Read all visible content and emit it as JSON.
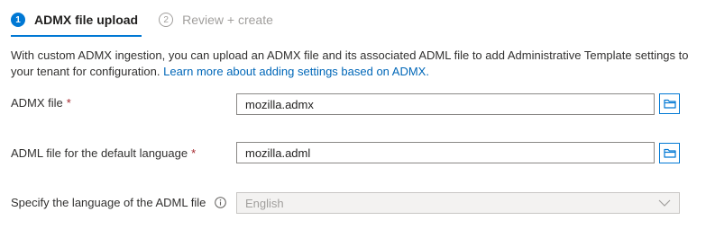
{
  "wizard": {
    "steps": [
      {
        "number": "1",
        "label": "ADMX file upload",
        "active": true
      },
      {
        "number": "2",
        "label": "Review + create",
        "active": false
      }
    ]
  },
  "description": {
    "text": "With custom ADMX ingestion, you can upload an ADMX file and its associated ADML file to add Administrative Template settings to your tenant for configuration. ",
    "link": "Learn more about adding settings based on ADMX."
  },
  "form": {
    "admx_file": {
      "label": "ADMX file",
      "required_marker": "*",
      "value": "mozilla.admx",
      "browse_icon": "folder-icon"
    },
    "adml_file": {
      "label": "ADML file for the default language",
      "required_marker": "*",
      "value": "mozilla.adml",
      "browse_icon": "folder-icon"
    },
    "language": {
      "label": "Specify the language of the ADML file",
      "info_icon": "info-icon",
      "selected": "English",
      "disabled": true
    }
  },
  "colors": {
    "accent": "#0078d4",
    "required": "#a4262c",
    "link": "#0067b8",
    "disabled_text": "#a19f9d"
  }
}
